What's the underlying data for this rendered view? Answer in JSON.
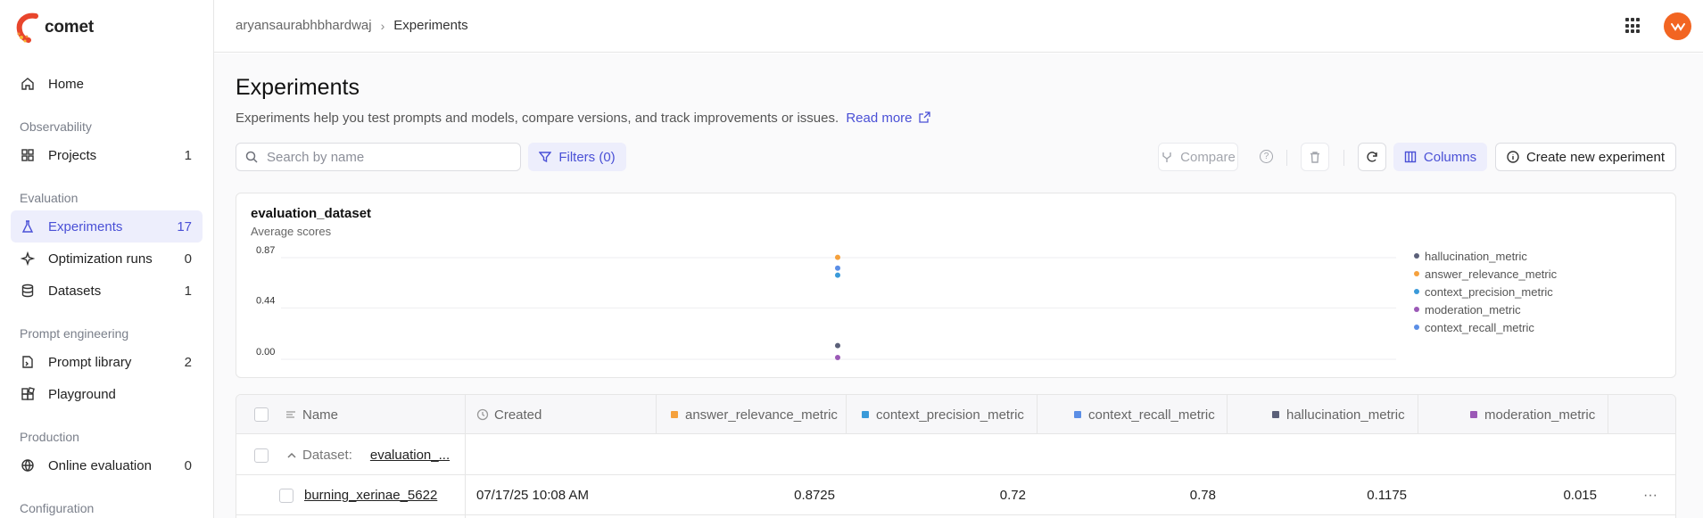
{
  "app": {
    "logo_text": "comet"
  },
  "sidebar": {
    "sections": [
      "Observability",
      "Evaluation",
      "Prompt engineering",
      "Production",
      "Configuration"
    ],
    "items": [
      {
        "label": "Home",
        "count": "",
        "icon": "home-icon"
      },
      {
        "label": "Projects",
        "count": "1",
        "icon": "grid-icon"
      },
      {
        "label": "Experiments",
        "count": "17",
        "icon": "flask-icon"
      },
      {
        "label": "Optimization runs",
        "count": "0",
        "icon": "sparkle-icon"
      },
      {
        "label": "Datasets",
        "count": "1",
        "icon": "database-icon"
      },
      {
        "label": "Prompt library",
        "count": "2",
        "icon": "file-icon"
      },
      {
        "label": "Playground",
        "count": "",
        "icon": "blocks-icon"
      },
      {
        "label": "Online evaluation",
        "count": "0",
        "icon": "globe-icon"
      }
    ]
  },
  "header": {
    "breadcrumb": [
      "aryansaurabhbhardwaj",
      "Experiments"
    ]
  },
  "page": {
    "title": "Experiments",
    "description": "Experiments help you test prompts and models, compare versions, and track improvements or issues.",
    "read_more": "Read more"
  },
  "toolbar": {
    "search_placeholder": "Search by name",
    "filters_label": "Filters (0)",
    "compare_label": "Compare",
    "columns_label": "Columns",
    "create_label": "Create new experiment"
  },
  "chart_data": {
    "type": "scatter",
    "title": "evaluation_dataset",
    "subtitle": "Average scores",
    "y_ticks": [
      "0.87",
      "0.44",
      "0.00"
    ],
    "ylim": [
      0,
      0.87
    ],
    "grid": true,
    "legend_position": "right",
    "series": [
      {
        "name": "hallucination_metric",
        "color": "#5b6079",
        "values": [
          0.1175
        ]
      },
      {
        "name": "answer_relevance_metric",
        "color": "#f5a13d",
        "values": [
          0.8725
        ]
      },
      {
        "name": "context_precision_metric",
        "color": "#3a9ad9",
        "values": [
          0.72
        ]
      },
      {
        "name": "moderation_metric",
        "color": "#9b59b6",
        "values": [
          0.015
        ]
      },
      {
        "name": "context_recall_metric",
        "color": "#5b8ee6",
        "values": [
          0.78
        ]
      }
    ]
  },
  "table": {
    "columns": [
      {
        "label": "Name",
        "color": ""
      },
      {
        "label": "Created",
        "color": ""
      },
      {
        "label": "answer_relevance_metric",
        "color": "#f5a13d"
      },
      {
        "label": "context_precision_metric",
        "color": "#3a9ad9"
      },
      {
        "label": "context_recall_metric",
        "color": "#5b8ee6"
      },
      {
        "label": "hallucination_metric",
        "color": "#5b6079"
      },
      {
        "label": "moderation_metric",
        "color": "#9b59b6"
      }
    ],
    "group": {
      "prefix": "Dataset:",
      "name": "evaluation_..."
    },
    "rows": [
      {
        "name": "burning_xerinae_5622",
        "created": "07/17/25 10:08 AM",
        "answer_relevance_metric": "0.8725",
        "context_precision_metric": "0.72",
        "context_recall_metric": "0.78",
        "hallucination_metric": "0.1175",
        "moderation_metric": "0.015"
      }
    ],
    "row_menu": "···"
  }
}
